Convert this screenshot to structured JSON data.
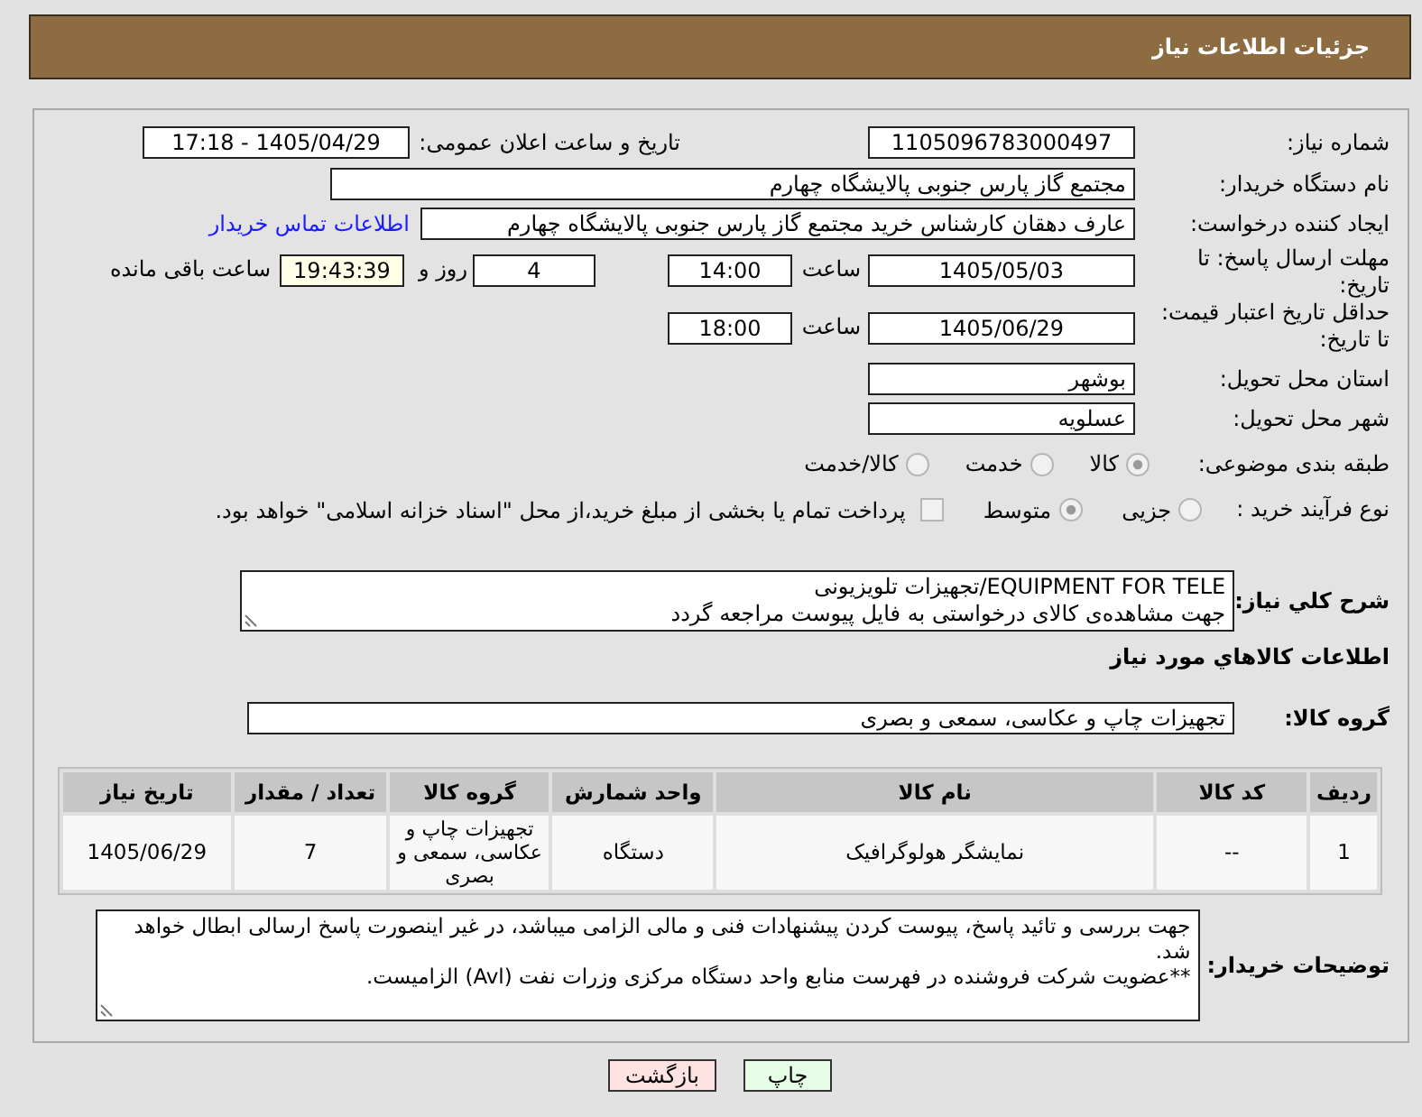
{
  "header": {
    "title": "جزئیات اطلاعات نیاز"
  },
  "need_info": {
    "need_number": {
      "label": "شماره نیاز:",
      "value": "1105096783000497"
    },
    "announce_datetime": {
      "label": "تاریخ و ساعت اعلان عمومی:",
      "value": "1405/04/29 - 17:18"
    },
    "buyer_org": {
      "label": "نام دستگاه خریدار:",
      "value": "مجتمع گاز پارس جنوبی  پالایشگاه چهارم"
    },
    "requester": {
      "label": "ایجاد کننده درخواست:",
      "value": "عارف دهقان کارشناس خرید مجتمع گاز پارس جنوبی  پالایشگاه چهارم",
      "link": "اطلاعات تماس خریدار"
    },
    "response_deadline": {
      "label": "مهلت ارسال پاسخ: تا تاریخ:",
      "date": "1405/05/03",
      "time_label": "ساعت",
      "time": "14:00",
      "days": "4",
      "days_label": "روز و",
      "remaining": "19:43:39",
      "remaining_label": "ساعت باقی مانده"
    },
    "price_validity": {
      "label": "حداقل تاریخ اعتبار قیمت: تا تاریخ:",
      "date": "1405/06/29",
      "time_label": "ساعت",
      "time": "18:00"
    },
    "delivery_province": {
      "label": "استان محل تحویل:",
      "value": "بوشهر"
    },
    "delivery_city": {
      "label": "شهر محل تحویل:",
      "value": "عسلویه"
    },
    "category": {
      "label": "طبقه بندی موضوعی:",
      "options": [
        {
          "label": "کالا",
          "selected": true
        },
        {
          "label": "خدمت",
          "selected": false
        },
        {
          "label": "کالا/خدمت",
          "selected": false
        }
      ]
    },
    "process_type": {
      "label": "نوع فرآیند خرید :",
      "options": [
        {
          "label": "جزیی",
          "selected": false
        },
        {
          "label": "متوسط",
          "selected": true
        }
      ],
      "treasury_payment": {
        "label": "پرداخت تمام یا بخشی از مبلغ خرید،از محل \"اسناد خزانه اسلامی\" خواهد بود.",
        "checked": false
      }
    }
  },
  "description": {
    "label": "شرح کلي نياز:",
    "lines": [
      "EQUIPMENT FOR TELE/تجهیزات تلویزیونی",
      "جهت مشاهده‌ی کالای درخواستی به فایل پیوست مراجعه گردد"
    ]
  },
  "items_section": {
    "title": "اطلاعات کالاهاي مورد نياز",
    "group_label": "گروه کالا:",
    "group_value": "تجهیزات چاپ و عکاسی، سمعی و بصری"
  },
  "table": {
    "columns": [
      "ردیف",
      "کد کالا",
      "نام کالا",
      "واحد شمارش",
      "گروه کالا",
      "تعداد / مقدار",
      "تاریخ نیاز"
    ],
    "rows": [
      [
        "1",
        "--",
        "نمایشگر هولوگرافیک",
        "دستگاه",
        "تجهیزات چاپ و عکاسی، سمعی و بصری",
        "7",
        "1405/06/29"
      ]
    ]
  },
  "buyer_notes": {
    "label": "توضیحات خریدار:",
    "lines": [
      "جهت بررسی و تائید پاسخ، پیوست کردن پیشنهادات فنی و مالی الزامی میباشد، در غیر اینصورت پاسخ ارسالی ابطال خواهد شد.",
      "**عضویت شرکت فروشنده در فهرست منابع واحد دستگاه مرکزی وزرات نفت (Avl) الزامیست."
    ]
  },
  "buttons": [
    {
      "kind": "print",
      "label": "چاپ"
    },
    {
      "kind": "back",
      "label": "بازگشت"
    }
  ]
}
